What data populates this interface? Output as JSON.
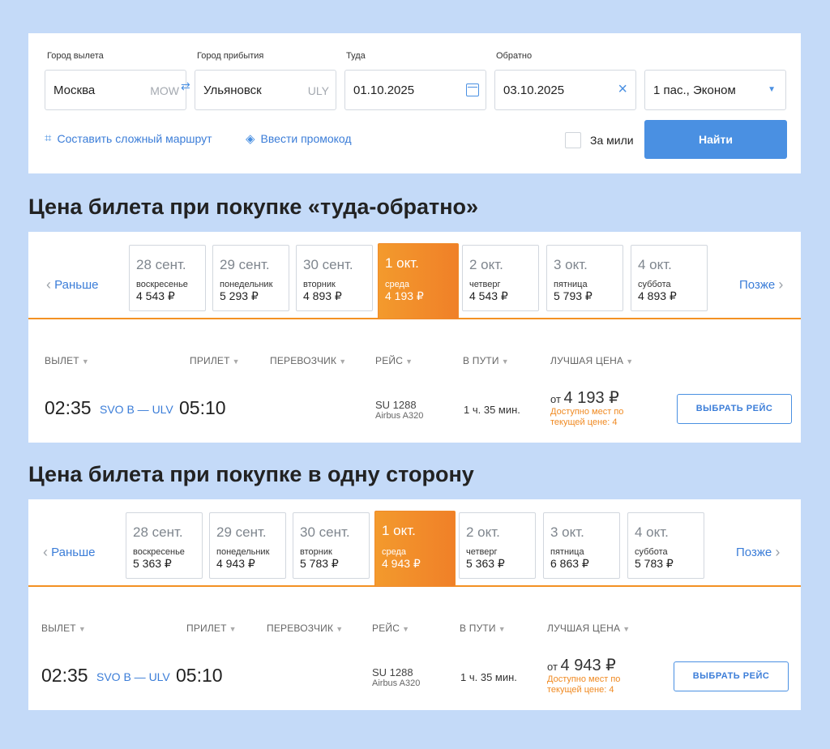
{
  "search": {
    "from_label": "Город вылета",
    "from_value": "Москва",
    "from_code": "MOW",
    "to_label": "Город прибытия",
    "to_value": "Ульяновск",
    "to_code": "ULY",
    "depart_label": "Туда",
    "depart_value": "01.10.2025",
    "return_label": "Обратно",
    "return_value": "03.10.2025",
    "passengers_value": "1 пас., Эконом",
    "complex_route_label": "Составить сложный маршрут",
    "promo_label": "Ввести промокод",
    "miles_label": "За мили",
    "find_label": "Найти",
    "icons": {
      "swap": "swap-arrows-icon",
      "calendar": "calendar-icon",
      "clear": "close-icon",
      "dropdown": "caret-down-icon",
      "route": "route-icon",
      "promo": "tag-icon"
    },
    "accent_color": "#4a90e2"
  },
  "sections": [
    {
      "heading": "Цена билета при покупке «туда-обратно»",
      "nav_prev": "Раньше",
      "nav_next": "Позже",
      "dates": [
        {
          "date": "28 сент.",
          "weekday": "воскресенье",
          "price": "4 543 ₽",
          "selected": false
        },
        {
          "date": "29 сент.",
          "weekday": "понедельник",
          "price": "5 293 ₽",
          "selected": false
        },
        {
          "date": "30 сент.",
          "weekday": "вторник",
          "price": "4 893 ₽",
          "selected": false
        },
        {
          "date": "1 окт.",
          "weekday": "среда",
          "price": "4 193 ₽",
          "selected": true
        },
        {
          "date": "2 окт.",
          "weekday": "четверг",
          "price": "4 543 ₽",
          "selected": false
        },
        {
          "date": "3 окт.",
          "weekday": "пятница",
          "price": "5 793 ₽",
          "selected": false
        },
        {
          "date": "4 окт.",
          "weekday": "суббота",
          "price": "4 893 ₽",
          "selected": false
        }
      ],
      "columns": {
        "depart": "ВЫЛЕТ",
        "arrive": "ПРИЛЕТ",
        "carrier": "ПЕРЕВОЗЧИК",
        "flight": "РЕЙС",
        "duration": "В ПУТИ",
        "best_price": "ЛУЧШАЯ ЦЕНА"
      },
      "flight": {
        "depart_time": "02:35",
        "route": "SVO B — ULV",
        "arrive_time": "05:10",
        "number": "SU 1288",
        "aircraft": "Airbus A320",
        "duration": "1 ч. 35 мин.",
        "price_prefix": "от",
        "price": "4 193 ₽",
        "availability": "Доступно мест по текущей цене: 4",
        "select_label": "ВЫБРАТЬ РЕЙС"
      }
    },
    {
      "heading": "Цена билета при покупке в одну сторону",
      "nav_prev": "Раньше",
      "nav_next": "Позже",
      "dates": [
        {
          "date": "28 сент.",
          "weekday": "воскресенье",
          "price": "5 363 ₽",
          "selected": false
        },
        {
          "date": "29 сент.",
          "weekday": "понедельник",
          "price": "4 943 ₽",
          "selected": false
        },
        {
          "date": "30 сент.",
          "weekday": "вторник",
          "price": "5 783 ₽",
          "selected": false
        },
        {
          "date": "1 окт.",
          "weekday": "среда",
          "price": "4 943 ₽",
          "selected": true
        },
        {
          "date": "2 окт.",
          "weekday": "четверг",
          "price": "5 363 ₽",
          "selected": false
        },
        {
          "date": "3 окт.",
          "weekday": "пятница",
          "price": "6 863 ₽",
          "selected": false
        },
        {
          "date": "4 окт.",
          "weekday": "суббота",
          "price": "5 783 ₽",
          "selected": false
        }
      ],
      "columns": {
        "depart": "ВЫЛЕТ",
        "arrive": "ПРИЛЕТ",
        "carrier": "ПЕРЕВОЗЧИК",
        "flight": "РЕЙС",
        "duration": "В ПУТИ",
        "best_price": "ЛУЧШАЯ ЦЕНА"
      },
      "flight": {
        "depart_time": "02:35",
        "route": "SVO B — ULV",
        "arrive_time": "05:10",
        "number": "SU 1288",
        "aircraft": "Airbus A320",
        "duration": "1 ч. 35 мин.",
        "price_prefix": "от",
        "price": "4 943 ₽",
        "availability": "Доступно мест по текущей цене: 4",
        "select_label": "ВЫБРАТЬ РЕЙС"
      }
    }
  ],
  "colors": {
    "background": "#c4daf8",
    "selected_date": "#f39123",
    "link": "#3b7dd8",
    "availability": "#f08a22"
  }
}
